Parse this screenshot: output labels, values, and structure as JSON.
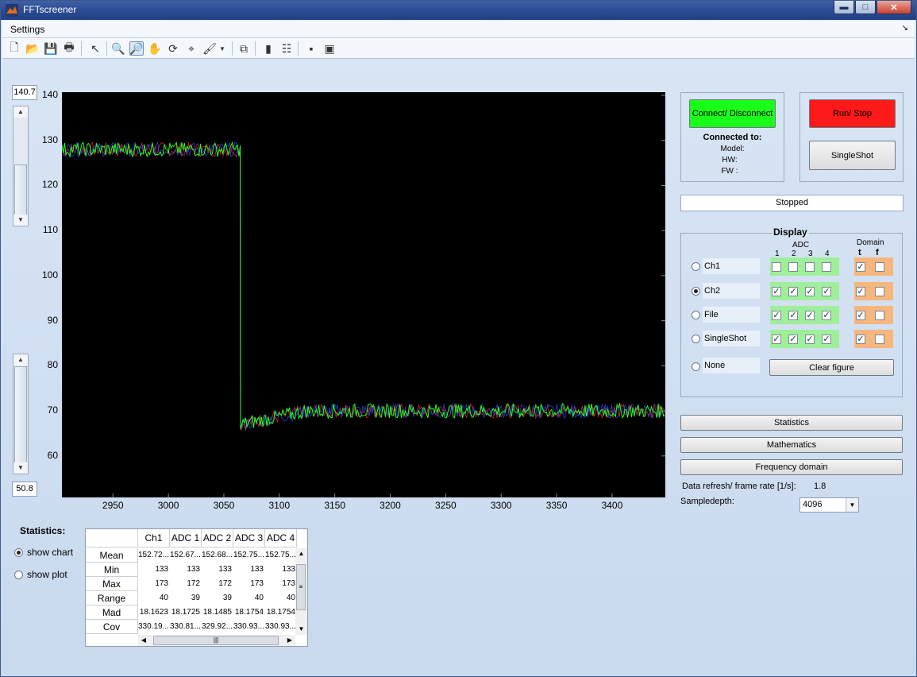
{
  "window": {
    "title": "FFTscreener"
  },
  "menu": {
    "settings": "Settings"
  },
  "plot": {
    "y_max_value": "140.7",
    "y_min_value": "50.8",
    "yticks": [
      "140",
      "130",
      "120",
      "110",
      "100",
      "90",
      "80",
      "70",
      "60"
    ],
    "xticks": [
      "2950",
      "3000",
      "3050",
      "3100",
      "3150",
      "3200",
      "3250",
      "3300",
      "3350",
      "3400"
    ]
  },
  "chart_data": {
    "type": "line",
    "xlim": [
      2904,
      3448
    ],
    "ylim": [
      50.8,
      140.7
    ],
    "grid": false,
    "series": [
      {
        "color": "#22ff22",
        "x": [
          2904,
          3065,
          3065,
          3448
        ],
        "values": [
          128,
          128,
          66,
          69
        ]
      }
    ]
  },
  "connection": {
    "connect_button": "Connect/ Disconnect",
    "connected_to": "Connected to:",
    "model": "Model:",
    "hw": "HW:",
    "fw": "FW :"
  },
  "run": {
    "run_stop": "Run/ Stop",
    "singleshot": "SingleShot"
  },
  "status": "Stopped",
  "display": {
    "title": "Display",
    "adc_header": "ADC",
    "adc_nums": [
      "1",
      "2",
      "3",
      "4"
    ],
    "domain_header": "Domain",
    "domain_t": "t",
    "domain_f": "f",
    "rows": [
      {
        "label": "Ch1",
        "selected": false,
        "adc": [
          false,
          false,
          false,
          false
        ],
        "t": true,
        "f": false
      },
      {
        "label": "Ch2",
        "selected": true,
        "adc": [
          true,
          true,
          true,
          true
        ],
        "t": true,
        "f": false
      },
      {
        "label": "File",
        "selected": false,
        "adc": [
          true,
          true,
          true,
          true
        ],
        "t": true,
        "f": false
      },
      {
        "label": "SingleShot",
        "selected": false,
        "adc": [
          true,
          true,
          true,
          true
        ],
        "t": true,
        "f": false
      }
    ],
    "none_label": "None",
    "clear_figure": "Clear figure"
  },
  "buttons": {
    "statistics": "Statistics",
    "mathematics": "Mathematics",
    "frequency": "Frequency domain"
  },
  "refresh": {
    "label": "Data refresh/ frame rate [1/s]:",
    "value": "1.8"
  },
  "sampledepth": {
    "label": "Sampledepth:",
    "value": "4096"
  },
  "statistics": {
    "title": "Statistics:",
    "show_chart": "show chart",
    "show_plot": "show plot",
    "columns": [
      "Ch1",
      "ADC 1",
      "ADC 2",
      "ADC 3",
      "ADC 4"
    ],
    "rows": [
      {
        "name": "Mean",
        "cells": [
          "152.72...",
          "152.67...",
          "152.68...",
          "152.75...",
          "152.75..."
        ]
      },
      {
        "name": "Min",
        "cells": [
          "133",
          "133",
          "133",
          "133",
          "133"
        ]
      },
      {
        "name": "Max",
        "cells": [
          "173",
          "172",
          "172",
          "173",
          "173"
        ]
      },
      {
        "name": "Range",
        "cells": [
          "40",
          "39",
          "39",
          "40",
          "40"
        ]
      },
      {
        "name": "Mad",
        "cells": [
          "18.1623",
          "18.1725",
          "18.1485",
          "18.1754",
          "18.1754"
        ]
      },
      {
        "name": "Cov",
        "cells": [
          "330.19...",
          "330.81...",
          "329.92...",
          "330.93...",
          "330.93..."
        ]
      }
    ]
  },
  "colors": {
    "connect": "#19ff19",
    "run": "#ff1a1a",
    "adc_bg": "#9fef9a",
    "domain_bg": "#f7b67c",
    "trace": "#22ff22"
  }
}
